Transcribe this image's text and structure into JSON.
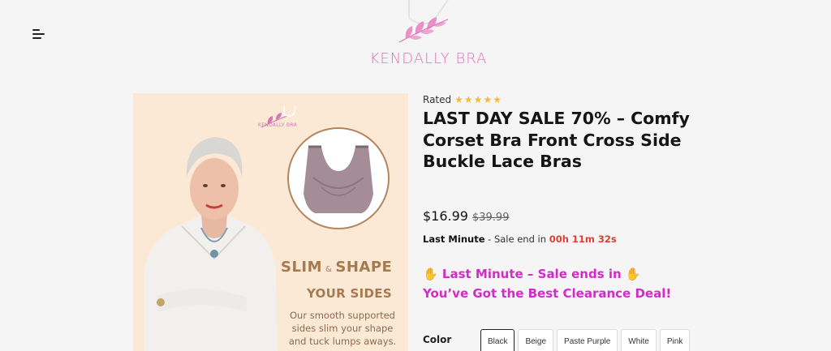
{
  "header": {
    "menu_icon": "hamburger-icon",
    "logo_text": "KENDALLY BRA"
  },
  "product": {
    "image": {
      "brand_text": "KENDALLY BRA",
      "headline_part1": "SLIM",
      "headline_amp": "&",
      "headline_part2": "SHAPE",
      "headline_line2": "YOUR SIDES",
      "caption": "Our smooth supported sides slim your shape and tuck lumps aways."
    },
    "rated_label": "Rated",
    "rating_stars": 5,
    "title": "LAST DAY SALE 70% – Comfy Corset Bra Front Cross Side Buckle Lace Bras",
    "price_current": "$16.99",
    "price_old": "$39.99",
    "countdown": {
      "label": "Last Minute",
      "text": "- Sale end in",
      "timer": "00h 11m 32s"
    },
    "promo_line1": "Last Minute – Sale ends in",
    "promo_line2": "You’ve Got the Best Clearance Deal!",
    "promo_emoji": "✋",
    "color_label": "Color",
    "colors": [
      "Black",
      "Beige",
      "Paste Purple",
      "White",
      "Pink"
    ],
    "selected_color": "Black"
  },
  "colors": {
    "accent_pink": "#d42ac8",
    "logo_pink": "#e46fb8",
    "timer_red": "#e03c31",
    "star_gold": "#f2bb3a",
    "image_bg": "#fbe9d6",
    "image_text": "#a47a50"
  }
}
